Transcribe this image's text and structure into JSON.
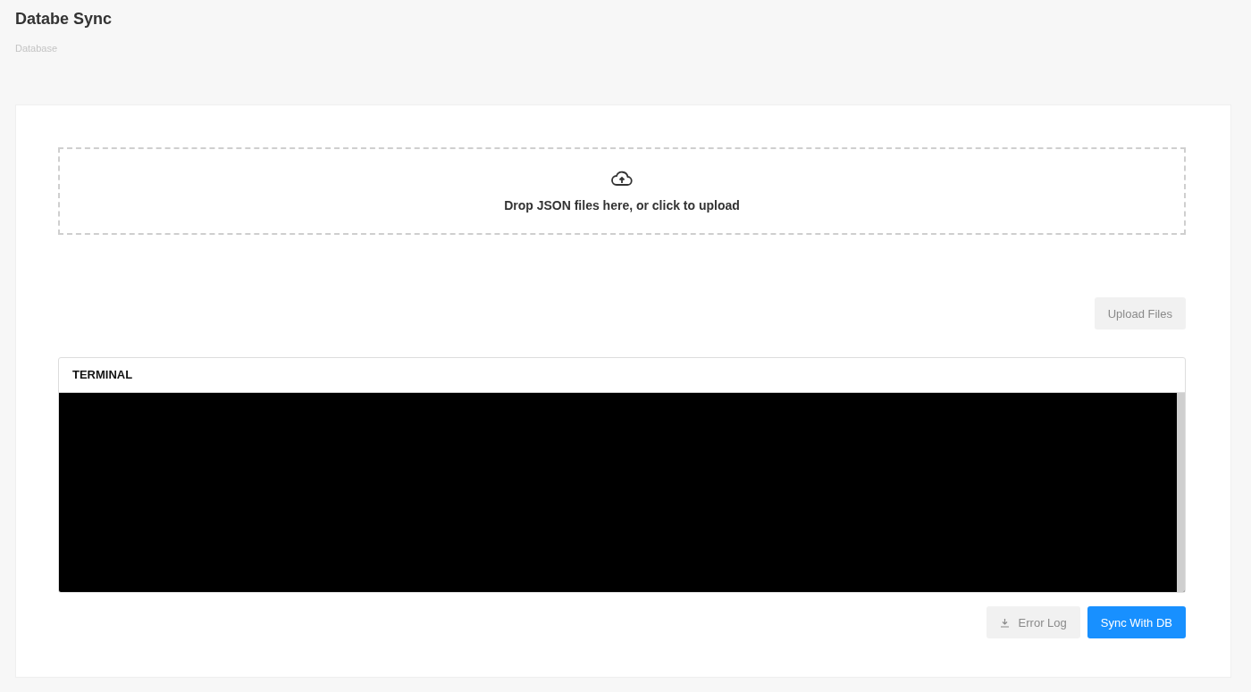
{
  "page": {
    "title": "Databe Sync",
    "breadcrumb": "Database"
  },
  "dropzone": {
    "text": "Drop JSON files here, or click to upload"
  },
  "upload_button": {
    "label": "Upload Files",
    "disabled": true
  },
  "terminal": {
    "title": "TERMINAL"
  },
  "actions": [
    {
      "label": "Error Log",
      "kind": "download",
      "disabled": true
    },
    {
      "label": "Sync With DB",
      "kind": "primary",
      "disabled": false
    }
  ]
}
